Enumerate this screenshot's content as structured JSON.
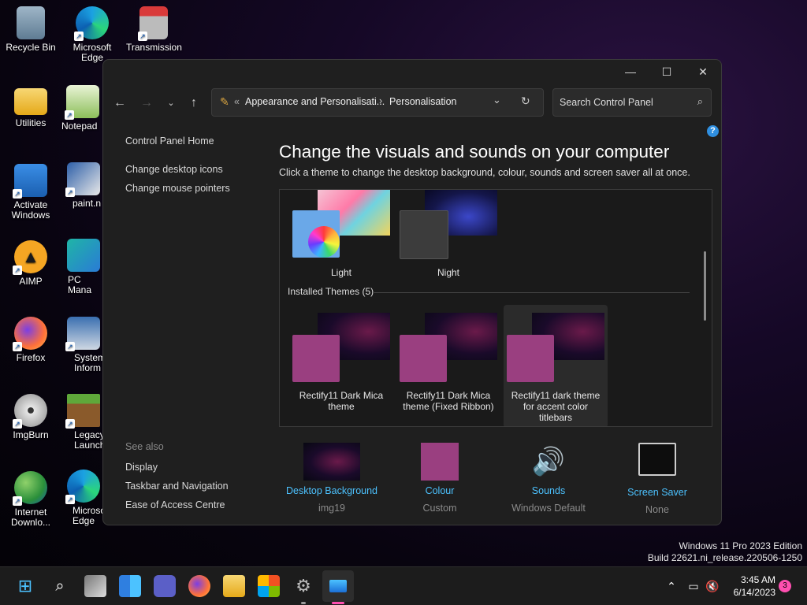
{
  "desktop_icons": [
    {
      "label": "Recycle Bin",
      "icon": "recycle-bin-icon"
    },
    {
      "label": "Microsoft Edge",
      "icon": "edge-icon"
    },
    {
      "label": "Transmission",
      "icon": "transmission-icon"
    },
    {
      "label": "Utilities",
      "icon": "folder-icon"
    },
    {
      "label": "Notepad",
      "icon": "notepad-icon"
    },
    {
      "label": "Activate Windows",
      "icon": "activate-windows-icon"
    },
    {
      "label": "paint.n",
      "icon": "paint-icon"
    },
    {
      "label": "AIMP",
      "icon": "aimp-icon"
    },
    {
      "label": "PC Mana",
      "icon": "pc-manager-icon"
    },
    {
      "label": "Firefox",
      "icon": "firefox-icon"
    },
    {
      "label": "System Inform",
      "icon": "system-info-icon"
    },
    {
      "label": "ImgBurn",
      "icon": "imgburn-icon"
    },
    {
      "label": "Legacy Launch",
      "icon": "minecraft-icon"
    },
    {
      "label": "Internet Downlo...",
      "icon": "idm-icon"
    },
    {
      "label": "Microsof Edge",
      "icon": "edge-icon"
    }
  ],
  "window": {
    "minimize": "—",
    "maximize": "☐",
    "close": "✕",
    "breadcrumb": {
      "sep_start": "«",
      "part1": "Appearance and Personalisati...",
      "sep": "›",
      "part2": "Personalisation"
    },
    "search_placeholder": "Search Control Panel",
    "help": "?"
  },
  "sidebar": {
    "home": "Control Panel Home",
    "links": [
      "Change desktop icons",
      "Change mouse pointers"
    ],
    "see_also_title": "See also",
    "see_also": [
      "Display",
      "Taskbar and Navigation",
      "Ease of Access Centre"
    ]
  },
  "main": {
    "heading": "Change the visuals and sounds on your computer",
    "subtitle": "Click a theme to change the desktop background, colour, sounds and screen saver all at once.",
    "themes_top": [
      {
        "name": "Light"
      },
      {
        "name": "Night"
      }
    ],
    "installed_label": "Installed Themes (5)",
    "installed": [
      {
        "name": "Rectify11 Dark Mica theme"
      },
      {
        "name": "Rectify11 Dark Mica theme (Fixed Ribbon)"
      },
      {
        "name": "Rectify11 dark theme for accent color titlebars"
      }
    ]
  },
  "bottom": [
    {
      "label": "Desktop Background",
      "sub": "img19"
    },
    {
      "label": "Colour",
      "sub": "Custom"
    },
    {
      "label": "Sounds",
      "sub": "Windows Default"
    },
    {
      "label": "Screen Saver",
      "sub": "None"
    }
  ],
  "watermark": {
    "line1": "Windows 11 Pro 2023 Edition",
    "line2": "Build 22621.ni_release.220506-1250"
  },
  "taskbar": {
    "time": "3:45 AM",
    "date": "6/14/2023",
    "notifications": "3"
  },
  "colors": {
    "accent_link": "#4cc2ff",
    "theme_square": "#9a3f80",
    "window_bg": "#1f1f1f"
  }
}
